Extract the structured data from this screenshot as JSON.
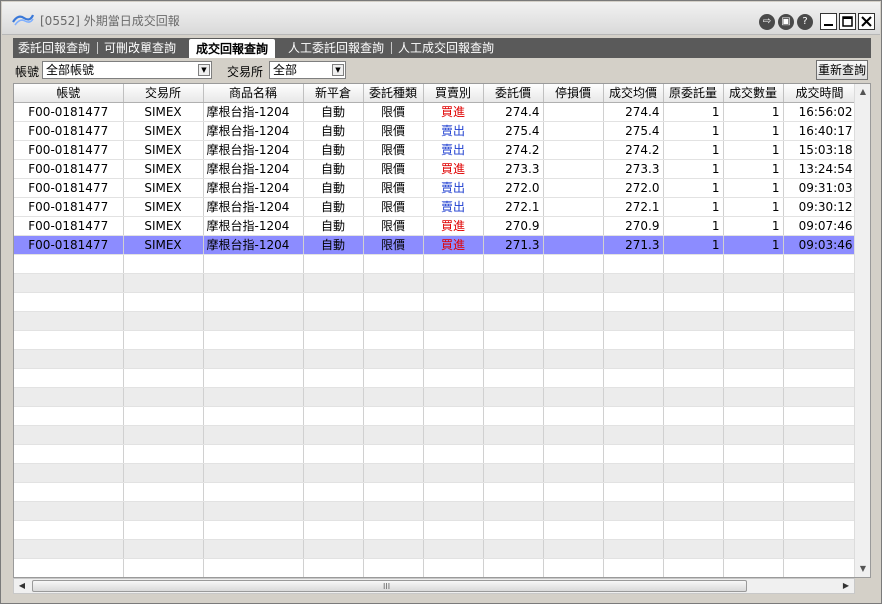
{
  "window": {
    "title": "[0552] 外期當日成交回報",
    "icons": [
      "logout-icon",
      "settings-icon",
      "help-icon",
      "minimize-icon",
      "maximize-icon",
      "close-icon"
    ]
  },
  "tabs": [
    {
      "label": "委託回報查詢",
      "active": false
    },
    {
      "label": "可刪改單查詢",
      "active": false
    },
    {
      "label": "成交回報查詢",
      "active": true
    },
    {
      "label": "人工委託回報查詢",
      "active": false
    },
    {
      "label": "人工成交回報查詢",
      "active": false
    }
  ],
  "filters": {
    "account_label": "帳號",
    "account_value": "全部帳號",
    "exchange_label": "交易所",
    "exchange_value": "全部",
    "refresh_label": "重新查詢"
  },
  "table": {
    "columns": [
      "帳號",
      "交易所",
      "商品名稱",
      "新平倉",
      "委託種類",
      "買賣別",
      "委託價",
      "停損價",
      "成交均價",
      "原委託量",
      "成交數量",
      "成交時間"
    ],
    "rows": [
      {
        "account": "F00-0181477",
        "exchange": "SIMEX",
        "product": "摩根台指-1204",
        "open_close": "自動",
        "order_type": "限價",
        "side": "買進",
        "order_price": "274.4",
        "stop_price": "",
        "avg_price": "274.4",
        "orig_qty": "1",
        "filled_qty": "1",
        "time": "16:56:02"
      },
      {
        "account": "F00-0181477",
        "exchange": "SIMEX",
        "product": "摩根台指-1204",
        "open_close": "自動",
        "order_type": "限價",
        "side": "賣出",
        "order_price": "275.4",
        "stop_price": "",
        "avg_price": "275.4",
        "orig_qty": "1",
        "filled_qty": "1",
        "time": "16:40:17"
      },
      {
        "account": "F00-0181477",
        "exchange": "SIMEX",
        "product": "摩根台指-1204",
        "open_close": "自動",
        "order_type": "限價",
        "side": "賣出",
        "order_price": "274.2",
        "stop_price": "",
        "avg_price": "274.2",
        "orig_qty": "1",
        "filled_qty": "1",
        "time": "15:03:18"
      },
      {
        "account": "F00-0181477",
        "exchange": "SIMEX",
        "product": "摩根台指-1204",
        "open_close": "自動",
        "order_type": "限價",
        "side": "買進",
        "order_price": "273.3",
        "stop_price": "",
        "avg_price": "273.3",
        "orig_qty": "1",
        "filled_qty": "1",
        "time": "13:24:54"
      },
      {
        "account": "F00-0181477",
        "exchange": "SIMEX",
        "product": "摩根台指-1204",
        "open_close": "自動",
        "order_type": "限價",
        "side": "賣出",
        "order_price": "272.0",
        "stop_price": "",
        "avg_price": "272.0",
        "orig_qty": "1",
        "filled_qty": "1",
        "time": "09:31:03"
      },
      {
        "account": "F00-0181477",
        "exchange": "SIMEX",
        "product": "摩根台指-1204",
        "open_close": "自動",
        "order_type": "限價",
        "side": "賣出",
        "order_price": "272.1",
        "stop_price": "",
        "avg_price": "272.1",
        "orig_qty": "1",
        "filled_qty": "1",
        "time": "09:30:12"
      },
      {
        "account": "F00-0181477",
        "exchange": "SIMEX",
        "product": "摩根台指-1204",
        "open_close": "自動",
        "order_type": "限價",
        "side": "買進",
        "order_price": "270.9",
        "stop_price": "",
        "avg_price": "270.9",
        "orig_qty": "1",
        "filled_qty": "1",
        "time": "09:07:46"
      },
      {
        "account": "F00-0181477",
        "exchange": "SIMEX",
        "product": "摩根台指-1204",
        "open_close": "自動",
        "order_type": "限價",
        "side": "買進",
        "order_price": "271.3",
        "stop_price": "",
        "avg_price": "271.3",
        "orig_qty": "1",
        "filled_qty": "1",
        "time": "09:03:46",
        "selected": true
      }
    ]
  },
  "colors": {
    "buy": "#e00000",
    "sell": "#1f3fd0",
    "selected_row": "#8c8cff",
    "tab_bar": "#5a5a5a"
  },
  "scrollbar": {
    "grip": "III"
  }
}
